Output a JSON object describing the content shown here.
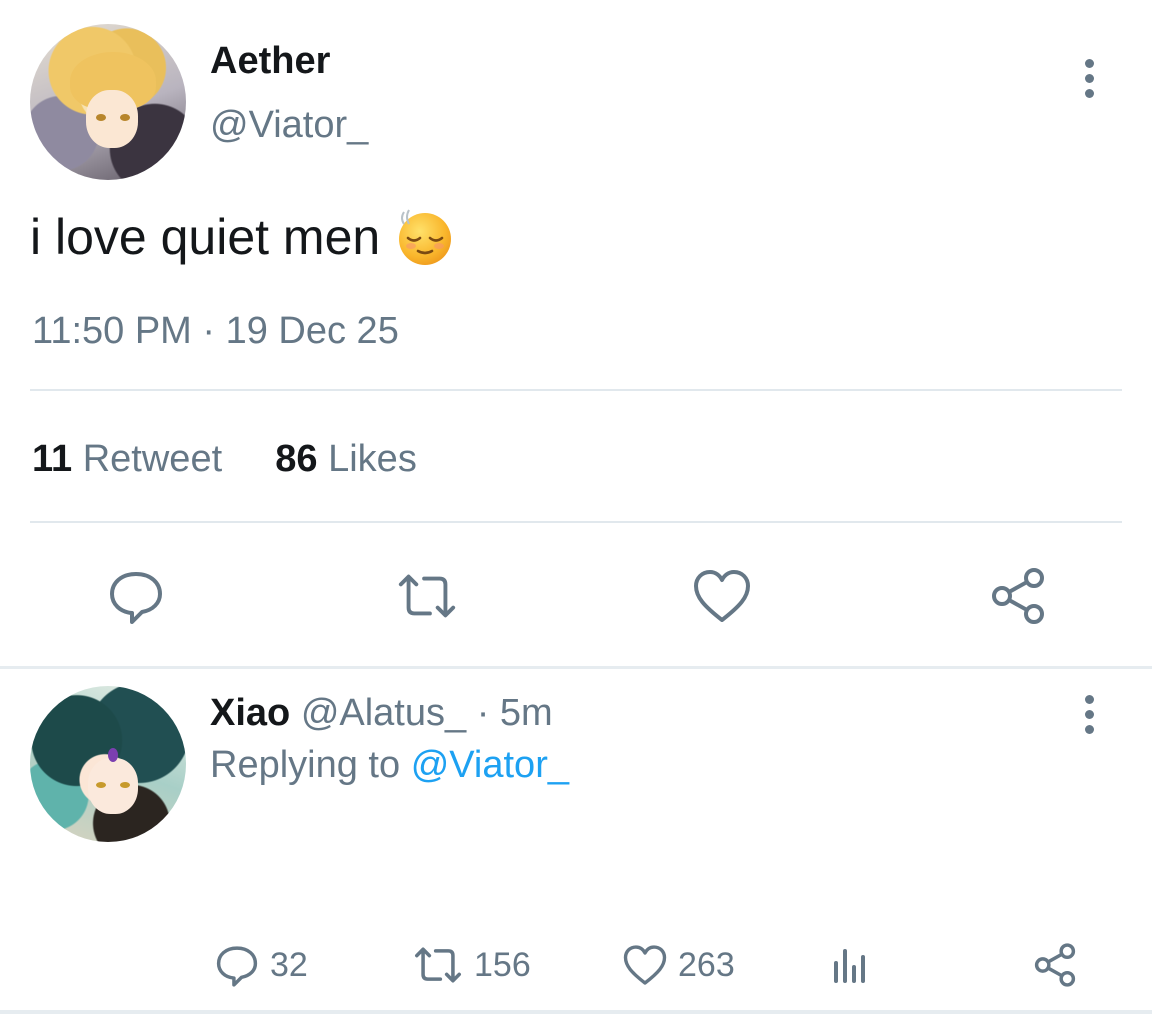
{
  "tweet": {
    "display_name": "Aether",
    "handle": "@Viator_",
    "text": "i love quiet men",
    "emoji": "relieved-face",
    "timestamp": "11:50 PM · 19 Dec 25",
    "stats": {
      "retweets_count": "11",
      "retweets_label": "Retweet",
      "likes_count": "86",
      "likes_label": "Likes"
    },
    "actions": [
      "reply-icon",
      "retweet-icon",
      "like-icon",
      "share-icon"
    ]
  },
  "reply": {
    "display_name": "Xiao",
    "handle": "@Alatus_",
    "separator": "·",
    "time": "5m",
    "replying_prefix": "Replying to",
    "replying_mention": "@Viator_",
    "counts": {
      "replies": "32",
      "retweets": "156",
      "likes": "263"
    }
  },
  "colors": {
    "text_primary": "#14171a",
    "text_secondary": "#657786",
    "link": "#1da1f2",
    "divider": "#e1e8ed"
  }
}
